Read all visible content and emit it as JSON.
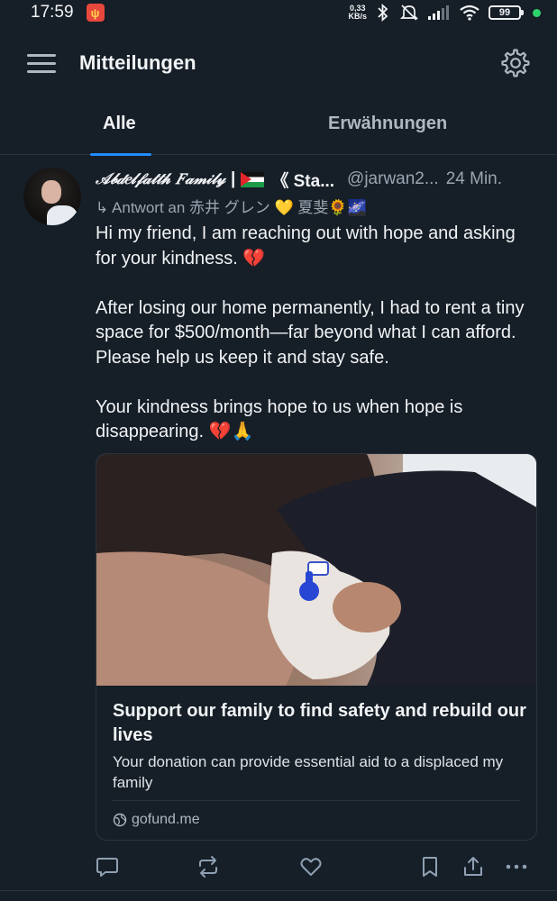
{
  "status_bar": {
    "time": "17:59",
    "net_speed_value": "0,33",
    "net_speed_unit": "KB/s",
    "battery": "99"
  },
  "header": {
    "title": "Mitteilungen"
  },
  "tabs": [
    {
      "label": "Alle",
      "active": true
    },
    {
      "label": "Erwähnungen",
      "active": false
    }
  ],
  "post": {
    "display_name": "𝒜𝒷𝒹𝑒𝓁𝒻𝒶𝓉𝓉𝒽 𝐹𝒶𝓂𝒾𝓁𝓎",
    "separator": "|",
    "name_suffix": "《 Sta...",
    "handle": "@jarwan2...",
    "time_ago": "24 Min.",
    "reply_to": "↳ Antwort an 赤井 グレン 💛 夏斐🌻🌌",
    "text": "Hi my friend, I am reaching out with hope and asking for your kindness. 💔\n\n After losing our home permanently, I had to rent a tiny space for $500/month—far beyond what I can afford. Please help us keep it and stay safe.\n\nYour kindness brings hope to us when hope is disappearing. 💔🙏",
    "card": {
      "title": "Support our family to find safety and rebuild our lives",
      "description": "Your donation can provide essential aid to a displaced my family",
      "domain": "gofund.me"
    }
  },
  "colors": {
    "background": "#161e27",
    "accent": "#1f8dff",
    "muted_text": "#9aa6b2",
    "divider": "#2a343f"
  },
  "icons": {
    "menu": "hamburger-icon",
    "settings": "gear-icon",
    "reply": "speech-bubble-icon",
    "repost": "repost-arrows-icon",
    "like": "heart-icon",
    "bookmark": "bookmark-icon",
    "share": "share-upload-icon",
    "more": "ellipsis-icon"
  }
}
